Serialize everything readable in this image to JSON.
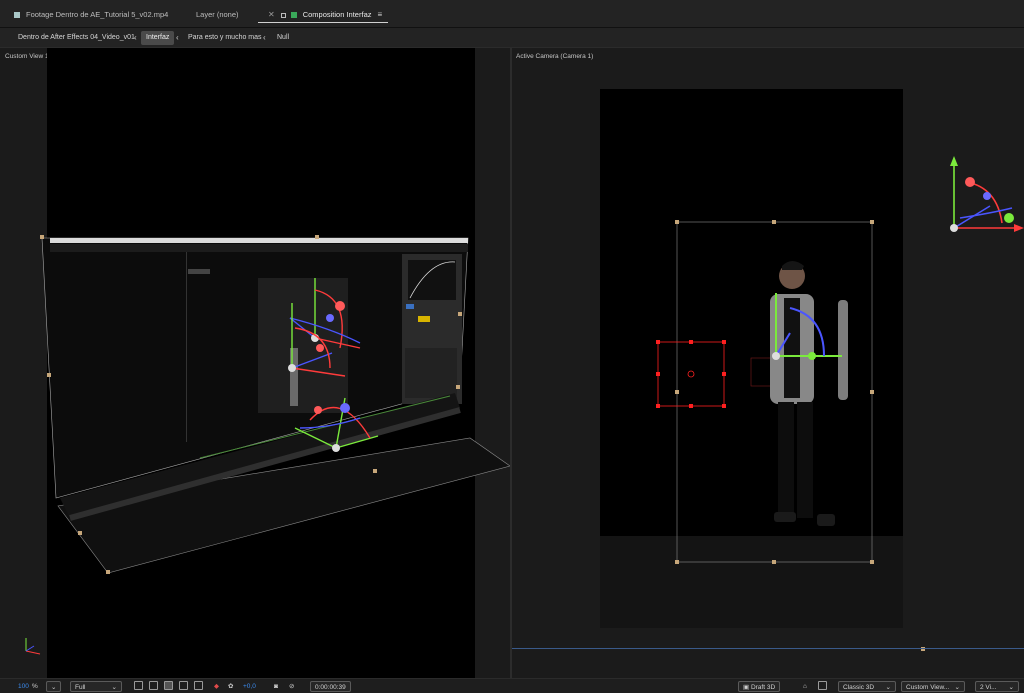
{
  "tabs": [
    {
      "label": "Footage Dentro de AE_Tutorial 5_v02.mp4",
      "swatch": "#a9c7c7"
    },
    {
      "label": "Layer (none)"
    },
    {
      "label": "Composition Interfaz",
      "swatch": "#3aa85a",
      "active": true
    }
  ],
  "breadcrumb": {
    "items": [
      "Dentro de After Effects 04_Video_v01",
      "Interfaz",
      "Para esto y mucho mas",
      "Null"
    ],
    "active_index": 1
  },
  "viewers": {
    "left_label": "Custom View 1",
    "right_label": "Active Camera (Camera 1)"
  },
  "toolbar": {
    "zoom_value": "100",
    "zoom_unit": "%",
    "resolution": "Full",
    "exposure": "+0,0",
    "timecode": "0:00:00:39",
    "draft3d": "Draft 3D",
    "renderer": "Classic 3D",
    "view": "Custom View...",
    "views_layout": "2 Vi..."
  },
  "colors": {
    "accent_blue": "#3c8cf0",
    "axis_x": "#ff3b3b",
    "axis_y": "#7bea3c",
    "axis_z": "#4a55ff"
  }
}
